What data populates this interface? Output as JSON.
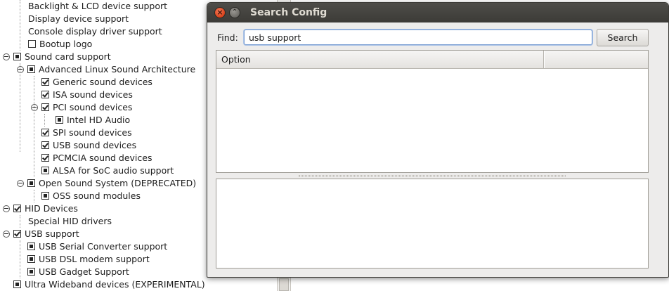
{
  "tree": {
    "items": [
      {
        "label": "Backlight & LCD device support",
        "checkbox": "none",
        "expander": false
      },
      {
        "label": "Display device support",
        "checkbox": "none",
        "expander": false
      },
      {
        "label": "Console display driver support",
        "checkbox": "none",
        "expander": false
      },
      {
        "label": "Bootup logo",
        "checkbox": "off",
        "expander": false
      },
      {
        "label": "Sound card support",
        "checkbox": "mod",
        "expander": true
      },
      {
        "label": "Advanced Linux Sound Architecture",
        "checkbox": "mod",
        "expander": true
      },
      {
        "label": "Generic sound devices",
        "checkbox": "yes",
        "expander": false
      },
      {
        "label": "ISA sound devices",
        "checkbox": "yes",
        "expander": false
      },
      {
        "label": "PCI sound devices",
        "checkbox": "yes",
        "expander": true
      },
      {
        "label": "Intel HD Audio",
        "checkbox": "mod",
        "expander": false
      },
      {
        "label": "SPI sound devices",
        "checkbox": "yes",
        "expander": false
      },
      {
        "label": "USB sound devices",
        "checkbox": "yes",
        "expander": false
      },
      {
        "label": "PCMCIA sound devices",
        "checkbox": "yes",
        "expander": false
      },
      {
        "label": "ALSA for SoC audio support",
        "checkbox": "mod",
        "expander": false
      },
      {
        "label": "Open Sound System (DEPRECATED)",
        "checkbox": "mod",
        "expander": true
      },
      {
        "label": "OSS sound modules",
        "checkbox": "mod",
        "expander": false
      },
      {
        "label": "HID Devices",
        "checkbox": "yes",
        "expander": true
      },
      {
        "label": "Special HID drivers",
        "checkbox": "none",
        "expander": false
      },
      {
        "label": "USB support",
        "checkbox": "yes",
        "expander": true
      },
      {
        "label": "USB Serial Converter support",
        "checkbox": "mod",
        "expander": false
      },
      {
        "label": "USB DSL modem support",
        "checkbox": "mod",
        "expander": false
      },
      {
        "label": "USB Gadget Support",
        "checkbox": "mod",
        "expander": false
      },
      {
        "label": "Ultra Wideband devices (EXPERIMENTAL)",
        "checkbox": "mod",
        "expander": false
      }
    ]
  },
  "dialog": {
    "title": "Search Config",
    "close_icon": "×",
    "minimize_icon": "⌃",
    "find_label": "Find:",
    "search_value": "usb support",
    "search_button": "Search",
    "columns": [
      "Option",
      ""
    ]
  },
  "colors": {
    "titlebar": "#3c3b37",
    "close_button": "#e0552f",
    "dialog_bg": "#edeceb",
    "focus_ring": "#7b9fd2"
  }
}
